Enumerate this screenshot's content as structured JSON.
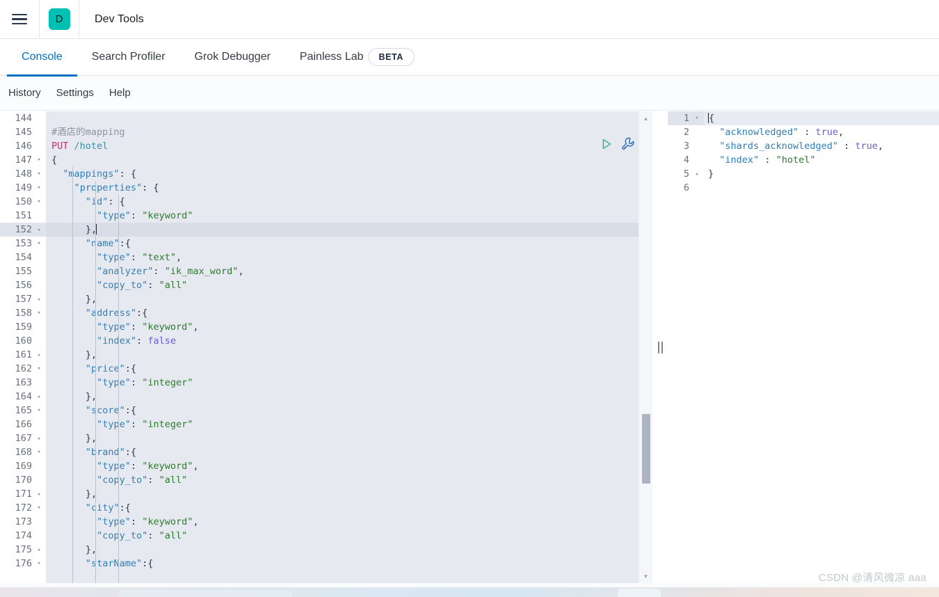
{
  "header": {
    "menu_icon": "hamburger-icon",
    "logo_letter": "D",
    "logo_color": "#00bfb3",
    "app_title": "Dev Tools"
  },
  "tabs": [
    {
      "label": "Console",
      "active": true
    },
    {
      "label": "Search Profiler",
      "active": false
    },
    {
      "label": "Grok Debugger",
      "active": false
    },
    {
      "label": "Painless Lab",
      "active": false,
      "badge": "BETA"
    }
  ],
  "subnav": [
    {
      "label": "History"
    },
    {
      "label": "Settings"
    },
    {
      "label": "Help"
    }
  ],
  "editor": {
    "active_line": 152,
    "first_line": 144,
    "run_icon": "play-icon",
    "wrench_icon": "wrench-icon",
    "scroll_up_icon": "triangle-up-icon",
    "scroll_down_icon": "triangle-down-icon",
    "lines": [
      {
        "n": 144,
        "fold": "",
        "code": ""
      },
      {
        "n": 145,
        "fold": "",
        "code": "#酒店的mapping",
        "type": "comment"
      },
      {
        "n": 146,
        "fold": "",
        "code": "PUT /hotel",
        "type": "request"
      },
      {
        "n": 147,
        "fold": "▾",
        "code": "{"
      },
      {
        "n": 148,
        "fold": "▾",
        "code": "  \"mappings\": {"
      },
      {
        "n": 149,
        "fold": "▾",
        "code": "    \"properties\": {"
      },
      {
        "n": 150,
        "fold": "▾",
        "code": "      \"id\": {"
      },
      {
        "n": 151,
        "fold": "",
        "code": "        \"type\": \"keyword\""
      },
      {
        "n": 152,
        "fold": "▴",
        "code": "      },",
        "cursor": true
      },
      {
        "n": 153,
        "fold": "▾",
        "code": "      \"name\":{"
      },
      {
        "n": 154,
        "fold": "",
        "code": "        \"type\": \"text\","
      },
      {
        "n": 155,
        "fold": "",
        "code": "        \"analyzer\": \"ik_max_word\","
      },
      {
        "n": 156,
        "fold": "",
        "code": "        \"copy_to\": \"all\""
      },
      {
        "n": 157,
        "fold": "▴",
        "code": "      },"
      },
      {
        "n": 158,
        "fold": "▾",
        "code": "      \"address\":{"
      },
      {
        "n": 159,
        "fold": "",
        "code": "        \"type\": \"keyword\","
      },
      {
        "n": 160,
        "fold": "",
        "code": "        \"index\": false"
      },
      {
        "n": 161,
        "fold": "▴",
        "code": "      },"
      },
      {
        "n": 162,
        "fold": "▾",
        "code": "      \"price\":{"
      },
      {
        "n": 163,
        "fold": "",
        "code": "        \"type\": \"integer\""
      },
      {
        "n": 164,
        "fold": "▴",
        "code": "      },"
      },
      {
        "n": 165,
        "fold": "▾",
        "code": "      \"score\":{"
      },
      {
        "n": 166,
        "fold": "",
        "code": "        \"type\": \"integer\""
      },
      {
        "n": 167,
        "fold": "▴",
        "code": "      },"
      },
      {
        "n": 168,
        "fold": "▾",
        "code": "      \"brand\":{"
      },
      {
        "n": 169,
        "fold": "",
        "code": "        \"type\": \"keyword\","
      },
      {
        "n": 170,
        "fold": "",
        "code": "        \"copy_to\": \"all\""
      },
      {
        "n": 171,
        "fold": "▴",
        "code": "      },"
      },
      {
        "n": 172,
        "fold": "▾",
        "code": "      \"city\":{"
      },
      {
        "n": 173,
        "fold": "",
        "code": "        \"type\": \"keyword\","
      },
      {
        "n": 174,
        "fold": "",
        "code": "        \"copy_to\": \"all\""
      },
      {
        "n": 175,
        "fold": "▴",
        "code": "      },"
      },
      {
        "n": 176,
        "fold": "▾",
        "code": "      \"starName\":{"
      }
    ]
  },
  "output": {
    "active_line": 1,
    "lines": [
      {
        "n": 1,
        "fold": "▾",
        "code": "{",
        "cursor": true
      },
      {
        "n": 2,
        "fold": "",
        "code": "  \"acknowledged\" : true,"
      },
      {
        "n": 3,
        "fold": "",
        "code": "  \"shards_acknowledged\" : true,"
      },
      {
        "n": 4,
        "fold": "",
        "code": "  \"index\" : \"hotel\""
      },
      {
        "n": 5,
        "fold": "▴",
        "code": "}"
      },
      {
        "n": 6,
        "fold": "",
        "code": ""
      }
    ]
  },
  "splitter": {
    "grip_icon": "drag-handle-icon"
  },
  "watermark": {
    "text": "CSDN @清风微凉 aaa"
  }
}
